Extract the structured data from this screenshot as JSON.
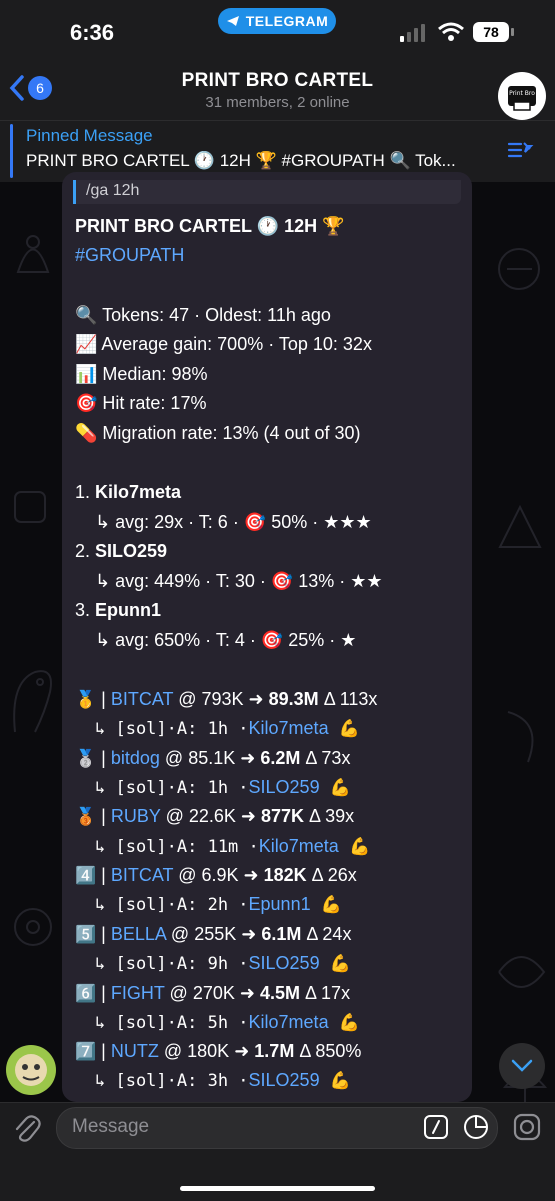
{
  "status": {
    "time": "6:36",
    "app_pill": "TELEGRAM",
    "battery": "78"
  },
  "header": {
    "back_count": "6",
    "title": "PRINT BRO CARTEL",
    "subtitle": "31 members, 2 online",
    "avatar_text": "Print Bro"
  },
  "pinned": {
    "label": "Pinned Message",
    "text": "PRINT BRO CARTEL 🕐 12H 🏆 #GROUPATH 🔍 Tok..."
  },
  "message": {
    "reply_text": "/ga 12h",
    "title_line": "PRINT BRO CARTEL 🕐 12H 🏆",
    "hashtag": "#GROUPATH",
    "stats": {
      "tokens": "🔍 Tokens: 47 · Oldest: 11h ago",
      "avg_gain": "📈 Average gain: 700% · Top 10: 32x",
      "median": "📊 Median: 98%",
      "hit_rate": "🎯 Hit rate: 17%",
      "migration": "💊 Migration rate: 13% (4 out of 30)"
    },
    "leaders": [
      {
        "rank": "1.",
        "name": "Kilo7meta",
        "detail": "↳ avg: 29x · T: 6 · 🎯 50% · ★★★"
      },
      {
        "rank": "2.",
        "name": "SILO259",
        "detail": "↳ avg: 449% · T: 30 · 🎯 13% · ★★"
      },
      {
        "rank": "3.",
        "name": "Epunn1",
        "detail": "↳ avg: 650% · T: 4 · 🎯 25% · ★"
      }
    ],
    "calls": [
      {
        "medal": "🥇",
        "token": "BITCAT",
        "entry": "@ 793K ➜",
        "peak": "89.3M",
        "delta": "Δ 113x",
        "age": "↳ [sol]·A: 1h ·",
        "caller": "Kilo7meta",
        "emoji": "💪"
      },
      {
        "medal": "🥈",
        "token": "bitdog",
        "entry": "@ 85.1K ➜",
        "peak": "6.2M",
        "delta": "Δ 73x",
        "age": "↳ [sol]·A: 1h ·",
        "caller": "SILO259",
        "emoji": "💪"
      },
      {
        "medal": "🥉",
        "token": "RUBY",
        "entry": "@ 22.6K ➜",
        "peak": "877K",
        "delta": "Δ 39x",
        "age": "↳ [sol]·A: 11m ·",
        "caller": "Kilo7meta",
        "emoji": "💪"
      },
      {
        "medal": "4️⃣",
        "token": "BITCAT",
        "entry": "@ 6.9K ➜",
        "peak": "182K",
        "delta": "Δ 26x",
        "age": "↳ [sol]·A: 2h ·",
        "caller": "Epunn1",
        "emoji": "💪"
      },
      {
        "medal": "5️⃣",
        "token": "BELLA",
        "entry": "@ 255K ➜",
        "peak": "6.1M",
        "delta": "Δ 24x",
        "age": "↳ [sol]·A: 9h ·",
        "caller": "SILO259",
        "emoji": "💪"
      },
      {
        "medal": "6️⃣",
        "token": "FIGHT",
        "entry": "@ 270K ➜",
        "peak": "4.5M",
        "delta": "Δ 17x",
        "age": "↳ [sol]·A: 5h ·",
        "caller": "Kilo7meta",
        "emoji": "💪"
      },
      {
        "medal": "7️⃣",
        "token": "NUTZ",
        "entry": "@ 180K ➜",
        "peak": "1.7M",
        "delta": "Δ 850%",
        "age": "↳ [sol]·A: 3h ·",
        "caller": "SILO259",
        "emoji": "💪"
      }
    ]
  },
  "input": {
    "placeholder": "Message"
  },
  "colors": {
    "accent": "#3478f6",
    "link": "#5ea8ff",
    "bubble": "#26232e"
  }
}
